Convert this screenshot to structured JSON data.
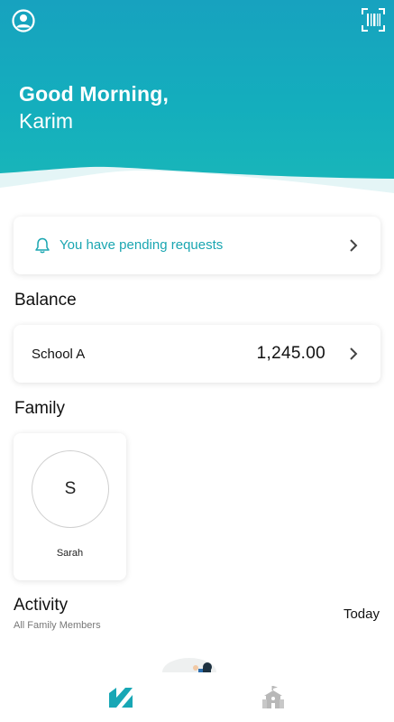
{
  "header": {
    "greeting": "Good Morning,",
    "username": "Karim",
    "profile_icon": "account-circle-icon",
    "scan_icon": "barcode-scan-icon"
  },
  "notification": {
    "text": "You have pending requests",
    "icon": "bell-icon"
  },
  "balance": {
    "title": "Balance",
    "items": [
      {
        "school": "School A",
        "amount": "1,245.00"
      }
    ]
  },
  "family": {
    "title": "Family",
    "members": [
      {
        "initial": "S",
        "name": "Sarah"
      }
    ]
  },
  "activity": {
    "title": "Activity",
    "subtitle": "All Family Members",
    "filter": "Today"
  },
  "nav": {
    "items": [
      {
        "icon": "home-logo-icon",
        "active": true
      },
      {
        "icon": "school-icon",
        "active": false
      }
    ]
  },
  "colors": {
    "header_start": "#17a2bf",
    "header_end": "#19b7b9",
    "accent": "#1aa6b1",
    "nav_inactive": "#b8b8b8"
  }
}
